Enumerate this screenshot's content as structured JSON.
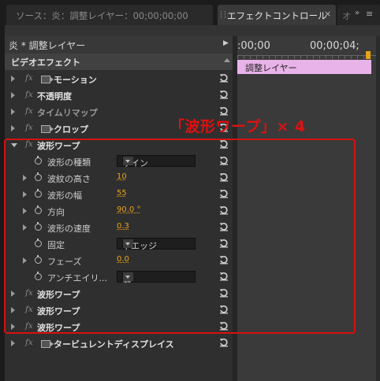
{
  "tabs": {
    "source": "ソース：炎：調整レイヤー：00;00;00;00",
    "effect_controls": "エフェクトコントロール",
    "close": "×",
    "more": "オ",
    "overflow": "»",
    "menu": "≡"
  },
  "panel": {
    "master_clip": "炎 * 調整レイヤー",
    "video_effects": "ビデオエフェクト",
    "fx_icon": "fx",
    "effects": {
      "motion": "モーション",
      "opacity": "不透明度",
      "time_remap": "タイムリマップ",
      "crop": "クロップ",
      "wave_warp": "波形ワープ",
      "turbulent": "タービュレントディスプレイス"
    },
    "wave_props": [
      {
        "label": "波形の種類",
        "type": "dropdown",
        "value": "サイン",
        "twirl": false
      },
      {
        "label": "波紋の高さ",
        "type": "number",
        "value": "10",
        "twirl": true
      },
      {
        "label": "波形の幅",
        "type": "number",
        "value": "55",
        "twirl": true
      },
      {
        "label": "方向",
        "type": "number",
        "value": "90.0 °",
        "twirl": true
      },
      {
        "label": "波形の速度",
        "type": "number",
        "value": "0.3",
        "twirl": true
      },
      {
        "label": "固定",
        "type": "dropdown",
        "value": "下エッジ",
        "twirl": false
      },
      {
        "label": "フェーズ",
        "type": "number",
        "value": "0.0",
        "twirl": true
      },
      {
        "label": "アンチエイリ...",
        "type": "dropdown",
        "value": "低",
        "twirl": false
      }
    ]
  },
  "timeline": {
    "timecode_start": ":00;00",
    "timecode_end": "00;00;04;",
    "clip_label": "調整レイヤー"
  },
  "annotation": {
    "label": "「波形ワープ」× 4",
    "color": "#e01010"
  },
  "colors": {
    "value_accent": "#e8a317",
    "clip_bar": "#e8b3e8"
  }
}
